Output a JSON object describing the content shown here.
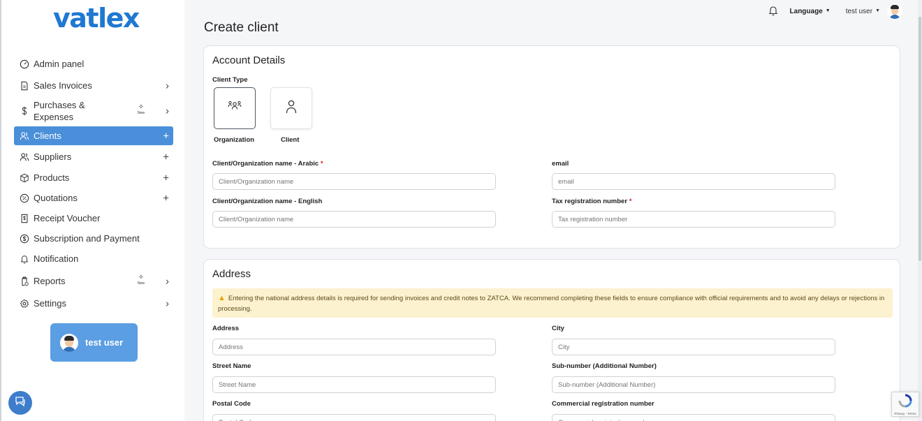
{
  "brand": {
    "logo": "vatlex"
  },
  "sidebar": {
    "items": [
      {
        "label": "Admin panel",
        "icon": "gauge-icon"
      },
      {
        "label": "Sales Invoices",
        "icon": "invoice-icon",
        "tail": "›"
      },
      {
        "label_line1": "Purchases &",
        "label_line2": "Expenses",
        "icon": "dollar-icon",
        "badge": "New",
        "tail": "›"
      },
      {
        "label": "Clients",
        "icon": "users-icon",
        "tail": "+"
      },
      {
        "label": "Suppliers",
        "icon": "users-icon",
        "tail": "+"
      },
      {
        "label": "Products",
        "icon": "box-icon",
        "tail": "+"
      },
      {
        "label": "Quotations",
        "icon": "percent-icon",
        "tail": "+"
      },
      {
        "label": "Receipt Voucher",
        "icon": "receipt-icon"
      },
      {
        "label": "Subscription and Payment",
        "icon": "dollar-circle-icon"
      },
      {
        "label": "Notification",
        "icon": "bell-icon"
      },
      {
        "label": "Reports",
        "icon": "report-icon",
        "badge": "New",
        "tail": "›"
      },
      {
        "label": "Settings",
        "icon": "gear-icon",
        "tail": "›"
      }
    ],
    "user_card": {
      "name": "test user"
    }
  },
  "topbar": {
    "language": "Language",
    "user": "test user"
  },
  "page": {
    "title": "Create client"
  },
  "account": {
    "title": "Account Details",
    "client_type_label": "Client Type",
    "types": [
      "Organization",
      "Client"
    ],
    "name_ar_label": "Client/Organization name - Arabic",
    "name_ar_placeholder": "Client/Organization name",
    "name_en_label": "Client/Organization name - English",
    "name_en_placeholder": "Client/Organization name",
    "email_label": "email",
    "email_placeholder": "email",
    "tax_label": "Tax registration number",
    "tax_placeholder": "Tax registration number",
    "required_mark": "*"
  },
  "address": {
    "title": "Address",
    "alert": "Entering the national address details is required for sending invoices and credit notes to ZATCA. We recommend completing these fields to ensure compliance with official requirements and to avoid any delays or rejections in processing.",
    "address_label": "Address",
    "address_placeholder": "Address",
    "city_label": "City",
    "city_placeholder": "City",
    "street_label": "Street Name",
    "street_placeholder": "Street Name",
    "subnumber_label": "Sub-number (Additional Number)",
    "subnumber_placeholder": "Sub-number (Additional Number)",
    "postal_label": "Postal Code",
    "postal_placeholder": "Postal Code",
    "cr_label": "Commercial registration number",
    "cr_placeholder": "Commercial registration number"
  },
  "recaptcha": {
    "text": "Privacy - Terms"
  },
  "colors": {
    "accent": "#4a8fd9",
    "logo": "#1f78d1",
    "alert_bg": "#fdf2cf",
    "required": "#d9232d"
  }
}
